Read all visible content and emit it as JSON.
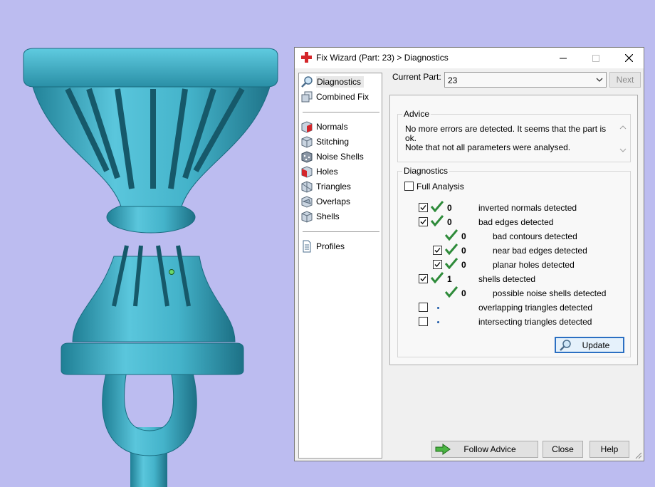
{
  "window": {
    "title": "Fix Wizard (Part: 23) > Diagnostics"
  },
  "nav": {
    "top_items": [
      {
        "label": "Diagnostics",
        "icon": "magnifier-icon",
        "selected": true
      },
      {
        "label": "Combined Fix",
        "icon": "combined-fix-icon"
      }
    ],
    "fix_items": [
      {
        "label": "Normals",
        "icon": "normals-cube-icon"
      },
      {
        "label": "Stitching",
        "icon": "stitching-cube-icon"
      },
      {
        "label": "Noise Shells",
        "icon": "noise-shells-cube-icon"
      },
      {
        "label": "Holes",
        "icon": "holes-cube-icon"
      },
      {
        "label": "Triangles",
        "icon": "triangles-cube-icon"
      },
      {
        "label": "Overlaps",
        "icon": "overlaps-cube-icon"
      },
      {
        "label": "Shells",
        "icon": "shells-cube-icon"
      }
    ],
    "profile_items": [
      {
        "label": "Profiles",
        "icon": "document-icon"
      }
    ]
  },
  "current_part": {
    "label": "Current Part:",
    "value": "23"
  },
  "buttons": {
    "next": "Next",
    "update": "Update",
    "follow_advice": "Follow Advice",
    "close": "Close",
    "help": "Help"
  },
  "advice": {
    "title": "Advice",
    "text": "No more errors are detected. It seems that the part is ok.\nNote that not all parameters were analysed."
  },
  "diagnostics": {
    "title": "Diagnostics",
    "full_analysis": {
      "label": "Full Analysis",
      "checked": false
    },
    "rows": [
      {
        "label": "inverted normals detected",
        "count": "0",
        "checked": true,
        "status": "ok",
        "indent": 0
      },
      {
        "label": "bad edges detected",
        "count": "0",
        "checked": true,
        "status": "ok",
        "indent": 0
      },
      {
        "label": "bad contours detected",
        "count": "0",
        "checkbox": false,
        "status": "ok",
        "indent": 1
      },
      {
        "label": "near bad edges detected",
        "count": "0",
        "checked": true,
        "status": "ok",
        "indent": 1
      },
      {
        "label": "planar holes detected",
        "count": "0",
        "checked": true,
        "status": "ok",
        "indent": 1
      },
      {
        "label": "shells detected",
        "count": "1",
        "checked": true,
        "status": "ok",
        "indent": 0
      },
      {
        "label": "possible noise shells detected",
        "count": "0",
        "checkbox": false,
        "status": "ok",
        "indent": 1
      },
      {
        "label": "overlapping triangles detected",
        "count": "",
        "checked": false,
        "status": "not-analysed",
        "indent": 0
      },
      {
        "label": "intersecting triangles detected",
        "count": "",
        "checked": false,
        "status": "not-analysed",
        "indent": 0
      }
    ]
  },
  "colors": {
    "background": "#bcbcf0",
    "model": "#3fb0c8",
    "check_green": "#2e8b3a",
    "window_accent": "#d4262a"
  }
}
